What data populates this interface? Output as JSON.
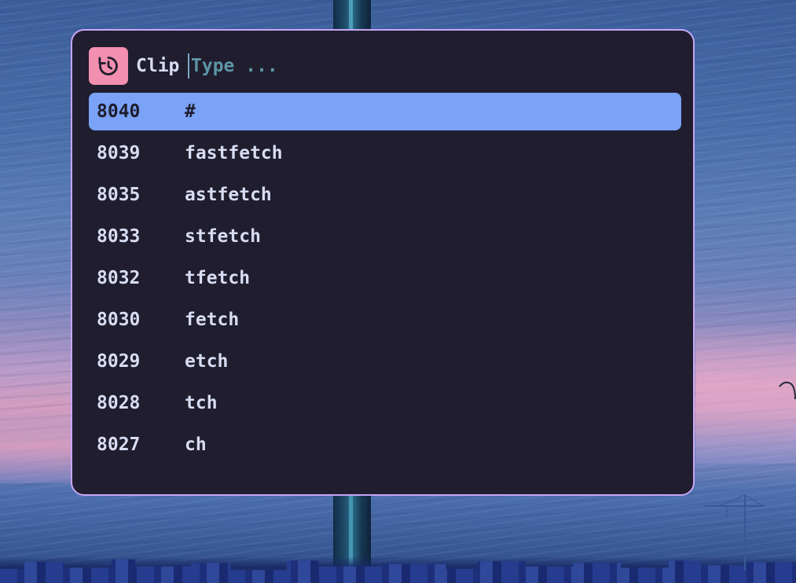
{
  "launcher": {
    "mode_icon": "history-icon",
    "mode_label": "Clip",
    "search": {
      "value": "",
      "placeholder": "Type ..."
    },
    "results": [
      {
        "id": "8040",
        "text": "#",
        "selected": true
      },
      {
        "id": "8039",
        "text": "fastfetch",
        "selected": false
      },
      {
        "id": "8035",
        "text": "astfetch",
        "selected": false
      },
      {
        "id": "8033",
        "text": "stfetch",
        "selected": false
      },
      {
        "id": "8032",
        "text": "tfetch",
        "selected": false
      },
      {
        "id": "8030",
        "text": "fetch",
        "selected": false
      },
      {
        "id": "8029",
        "text": "etch",
        "selected": false
      },
      {
        "id": "8028",
        "text": "tch",
        "selected": false
      },
      {
        "id": "8027",
        "text": "ch",
        "selected": false
      }
    ]
  },
  "colors": {
    "window_bg": "#1f1d2e",
    "border": "#c7a6f4",
    "mode_icon_bg": "#f38fb0",
    "selected_bg": "#7aa2f7",
    "text": "#d8dcf2",
    "placeholder": "#5d96a6"
  }
}
